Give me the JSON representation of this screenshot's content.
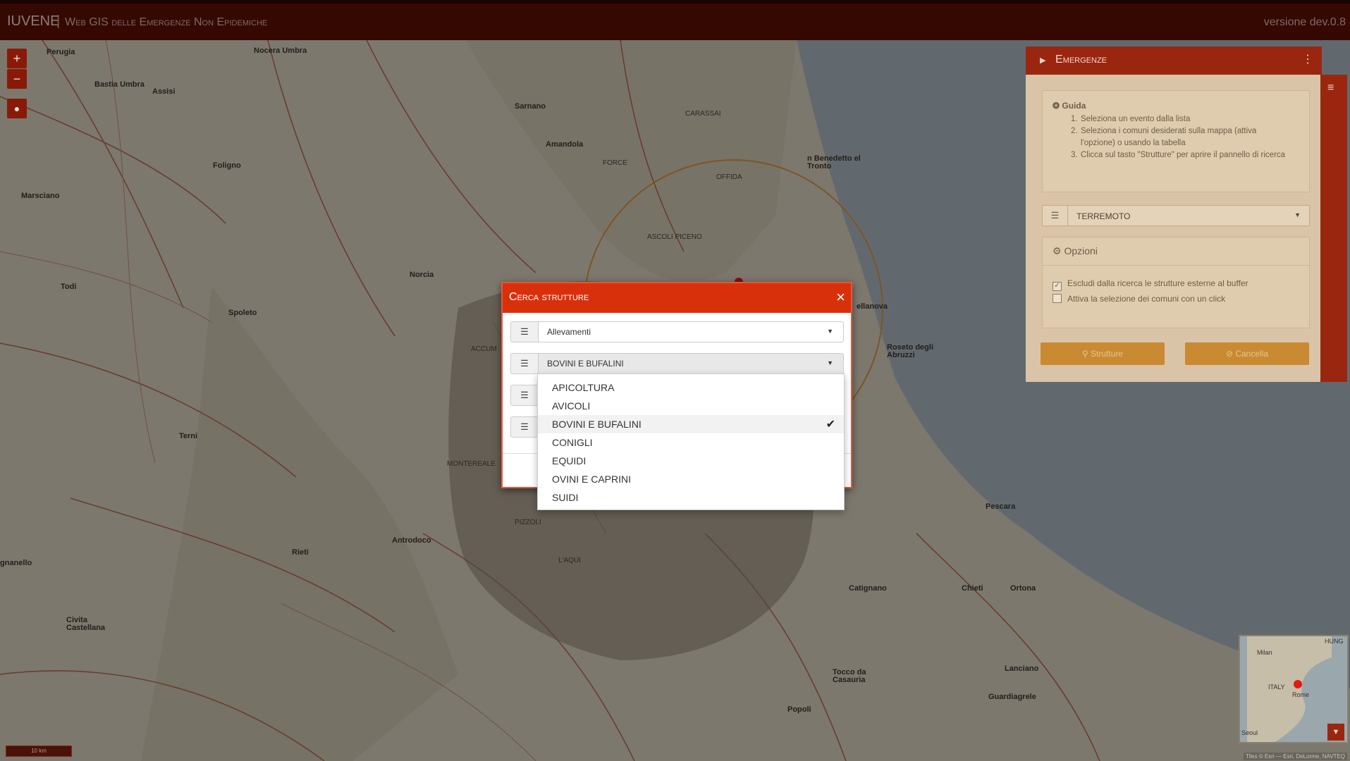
{
  "header": {
    "title": "IUVENE",
    "separator": "|",
    "subtitle": "Web GIS delle Emergenze Non Epidemiche",
    "version": "versione dev.0.8"
  },
  "map": {
    "zoom_in_label": "+",
    "zoom_out_label": "−",
    "scale_label": "10 km",
    "places": [
      {
        "name": "Perugia",
        "cls": ""
      },
      {
        "name": "Nocera Umbra",
        "cls": ""
      },
      {
        "name": "Bastia Umbra",
        "cls": ""
      },
      {
        "name": "Assisi",
        "cls": ""
      },
      {
        "name": "Foligno",
        "cls": ""
      },
      {
        "name": "Marsciano",
        "cls": ""
      },
      {
        "name": "Todi",
        "cls": ""
      },
      {
        "name": "Spoleto",
        "cls": ""
      },
      {
        "name": "Norcia",
        "cls": ""
      },
      {
        "name": "Terni",
        "cls": ""
      },
      {
        "name": "Rieti",
        "cls": ""
      },
      {
        "name": "Antrodoco",
        "cls": ""
      },
      {
        "name": "Civita Castellana",
        "cls": ""
      },
      {
        "name": "gnanello",
        "cls": ""
      },
      {
        "name": "Sarnano",
        "cls": ""
      },
      {
        "name": "Amandola",
        "cls": ""
      },
      {
        "name": "CARASSAI",
        "cls": "sm"
      },
      {
        "name": "FORCE",
        "cls": "sm"
      },
      {
        "name": "OFFIDA",
        "cls": "sm"
      },
      {
        "name": "ASCOLI PICENO",
        "cls": "sm"
      },
      {
        "name": "n Benedetto el Tronto",
        "cls": ""
      },
      {
        "name": "ellanova",
        "cls": ""
      },
      {
        "name": "Roseto degli Abruzzi",
        "cls": ""
      },
      {
        "name": "MONTEREALE",
        "cls": "sm"
      },
      {
        "name": "PIZZOLI",
        "cls": "sm"
      },
      {
        "name": "L'AQUI",
        "cls": "sm"
      },
      {
        "name": "Pescara",
        "cls": ""
      },
      {
        "name": "Chieti",
        "cls": ""
      },
      {
        "name": "Ortona",
        "cls": ""
      },
      {
        "name": "Catignano",
        "cls": ""
      },
      {
        "name": "Lanciano",
        "cls": ""
      },
      {
        "name": "Guardiagrele",
        "cls": ""
      },
      {
        "name": "Tocco da Casauria",
        "cls": ""
      },
      {
        "name": "Popoli",
        "cls": ""
      },
      {
        "name": "ACCUM",
        "cls": "sm"
      }
    ],
    "attribution": "Tiles © Esri — Esri, DeLorme, NAVTEQ"
  },
  "panel": {
    "title": "Emergenze",
    "guide": {
      "title": "Guida",
      "steps": [
        "Seleziona un evento dalla lista",
        "Seleziona i comuni desiderati sulla mappa (attiva l'opzione) o usando la tabella",
        "Clicca sul tasto \"Strutture\" per aprire il pannello di ricerca"
      ]
    },
    "event_value": "TERREMOTO",
    "options": {
      "title": "Opzioni",
      "exclude_label": "Escludi dalla ricerca le strutture esterne al buffer",
      "exclude_checked": true,
      "click_select_label": "Attiva la selezione dei comuni con un click",
      "click_select_checked": false
    },
    "structures_button": "Strutture",
    "cancel_button": "Cancella"
  },
  "minimap": {
    "labels": [
      "Milan",
      "ITALY",
      "Rome",
      "HUNG",
      "Seoul"
    ]
  },
  "modal": {
    "title": "Cerca strutture",
    "close": "×",
    "category_value": "Allevamenti",
    "species_value": "BOVINI E BUFALINI",
    "options": [
      {
        "label": "APICOLTURA",
        "selected": false
      },
      {
        "label": "AVICOLI",
        "selected": false
      },
      {
        "label": "BOVINI E BUFALINI",
        "selected": true
      },
      {
        "label": "CONIGLI",
        "selected": false
      },
      {
        "label": "EQUIDI",
        "selected": false
      },
      {
        "label": "OVINI E CAPRINI",
        "selected": false
      },
      {
        "label": "SUIDI",
        "selected": false
      }
    ]
  },
  "colors": {
    "header_bg": "#5e0f04",
    "accent": "#d9300c",
    "panel_accent": "#9b2610",
    "button": "#c98a32"
  }
}
